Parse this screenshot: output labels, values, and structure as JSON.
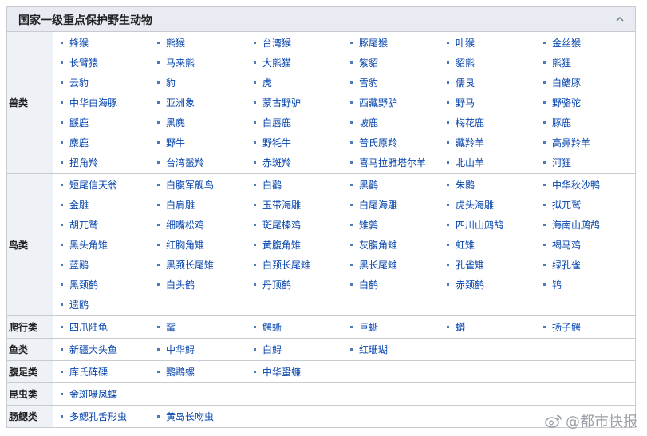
{
  "navbox": {
    "title": "国家一级重点保护野生动物",
    "groups": [
      {
        "label": "兽类",
        "items": [
          "蜂猴",
          "熊猴",
          "台湾猴",
          "豚尾猴",
          "叶猴",
          "金丝猴",
          "长臂猿",
          "马来熊",
          "大熊猫",
          "紫貂",
          "貂熊",
          "熊狸",
          "云豹",
          "豹",
          "虎",
          "雪豹",
          "儒艮",
          "白鳍豚",
          "中华白海豚",
          "亚洲象",
          "蒙古野驴",
          "西藏野驴",
          "野马",
          "野骆驼",
          "鼷鹿",
          "黑麂",
          "白唇鹿",
          "坡鹿",
          "梅花鹿",
          "豚鹿",
          "麋鹿",
          "野牛",
          "野牦牛",
          "普氏原羚",
          "藏羚羊",
          "高鼻羚羊",
          "扭角羚",
          "台湾鬣羚",
          "赤斑羚",
          "喜马拉雅塔尔羊",
          "北山羊",
          "河狸"
        ]
      },
      {
        "label": "鸟类",
        "items": [
          "短尾信天翁",
          "白腹军舰鸟",
          "白鹳",
          "黑鹳",
          "朱鹮",
          "中华秋沙鸭",
          "金雕",
          "白肩雕",
          "玉带海雕",
          "白尾海雕",
          "虎头海雕",
          "拟兀鹫",
          "胡兀鹫",
          "细嘴松鸡",
          "斑尾榛鸡",
          "雉鹑",
          "四川山鹧鸪",
          "海南山鹧鸪",
          "黑头角雉",
          "红胸角雉",
          "黄腹角雉",
          "灰腹角雉",
          "虹雉",
          "褐马鸡",
          "蓝鹇",
          "黑颈长尾雉",
          "白颈长尾雉",
          "黑长尾雉",
          "孔雀雉",
          "绿孔雀",
          "黑颈鹤",
          "白头鹤",
          "丹顶鹤",
          "白鹤",
          "赤颈鹤",
          "鸨",
          "遗鸥"
        ]
      },
      {
        "label": "爬行类",
        "items": [
          "四爪陆龟",
          "鼋",
          "鳄蜥",
          "巨蜥",
          "蟒",
          "扬子鳄"
        ]
      },
      {
        "label": "鱼类",
        "items": [
          "新疆大头鱼",
          "中华鲟",
          "白鲟",
          "红珊瑚"
        ]
      },
      {
        "label": "腹足类",
        "items": [
          "库氏砗磲",
          "鹦鹉螺",
          "中华蛩蠊"
        ]
      },
      {
        "label": "昆虫类",
        "items": [
          "金斑喙凤蝶"
        ]
      },
      {
        "label": "肠鳃类",
        "items": [
          "多鳃孔舌形虫",
          "黄岛长吻虫"
        ]
      }
    ]
  },
  "watermark": {
    "text": "@都市快报",
    "icon": "weibo-icon"
  },
  "colors": {
    "link": "#0645ad",
    "header_bg": "#e8ecf2",
    "label_bg": "#eef1f6",
    "border": "#c8ccd1"
  }
}
